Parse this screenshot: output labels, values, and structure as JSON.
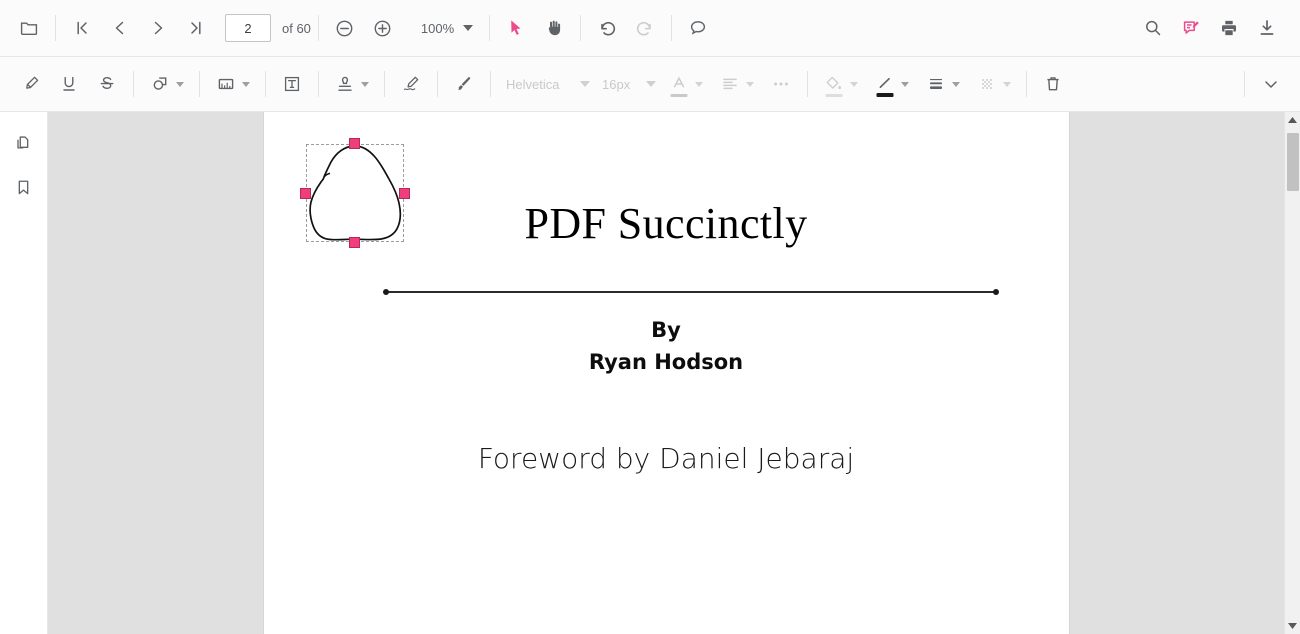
{
  "toolbar": {
    "open_file_label": "Open file",
    "first_page_label": "First page",
    "prev_page_label": "Previous page",
    "next_page_label": "Next page",
    "last_page_label": "Last page",
    "current_page": "2",
    "page_total_label": "of 60",
    "zoom_out_label": "Zoom out",
    "zoom_in_label": "Zoom in",
    "zoom_level": "100%",
    "select_tool_label": "Select",
    "pan_tool_label": "Pan",
    "undo_label": "Undo",
    "redo_label": "Redo",
    "comment_label": "Add comment",
    "search_label": "Search",
    "annotate_label": "Annotations",
    "print_label": "Print",
    "download_label": "Download"
  },
  "annotation_toolbar": {
    "highlight_label": "Highlight",
    "underline_label": "Underline",
    "strikethrough_label": "Strikethrough",
    "shape_label": "Shapes",
    "image_label": "Image",
    "textbox_label": "Text box",
    "stamp_label": "Stamp",
    "signature_label": "Signature",
    "brush_label": "Free hand",
    "font_family": "Helvetica",
    "font_size": "16px",
    "font_color_label": "Font color",
    "align_label": "Alignment",
    "more_label": "More options",
    "fill_color_label": "Fill color",
    "stroke_color_label": "Stroke color",
    "thickness_label": "Line thickness",
    "opacity_label": "Opacity",
    "delete_label": "Delete",
    "collapse_label": "Collapse toolbar",
    "stroke_color": "#1a1a1a",
    "accent_color": "#ed4c8c"
  },
  "sidebar": {
    "thumbnails_label": "Page thumbnails",
    "bookmarks_label": "Bookmarks"
  },
  "document": {
    "title": "PDF Succinctly",
    "by_label": "By",
    "author": "Ryan Hodson",
    "foreword": "Foreword by Daniel Jebaraj",
    "ink_annotation_label": "Ink annotation"
  },
  "scrollbar": {
    "scroll_up_label": "Scroll up",
    "scroll_down_label": "Scroll down",
    "thumb_label": "Scroll thumb"
  }
}
